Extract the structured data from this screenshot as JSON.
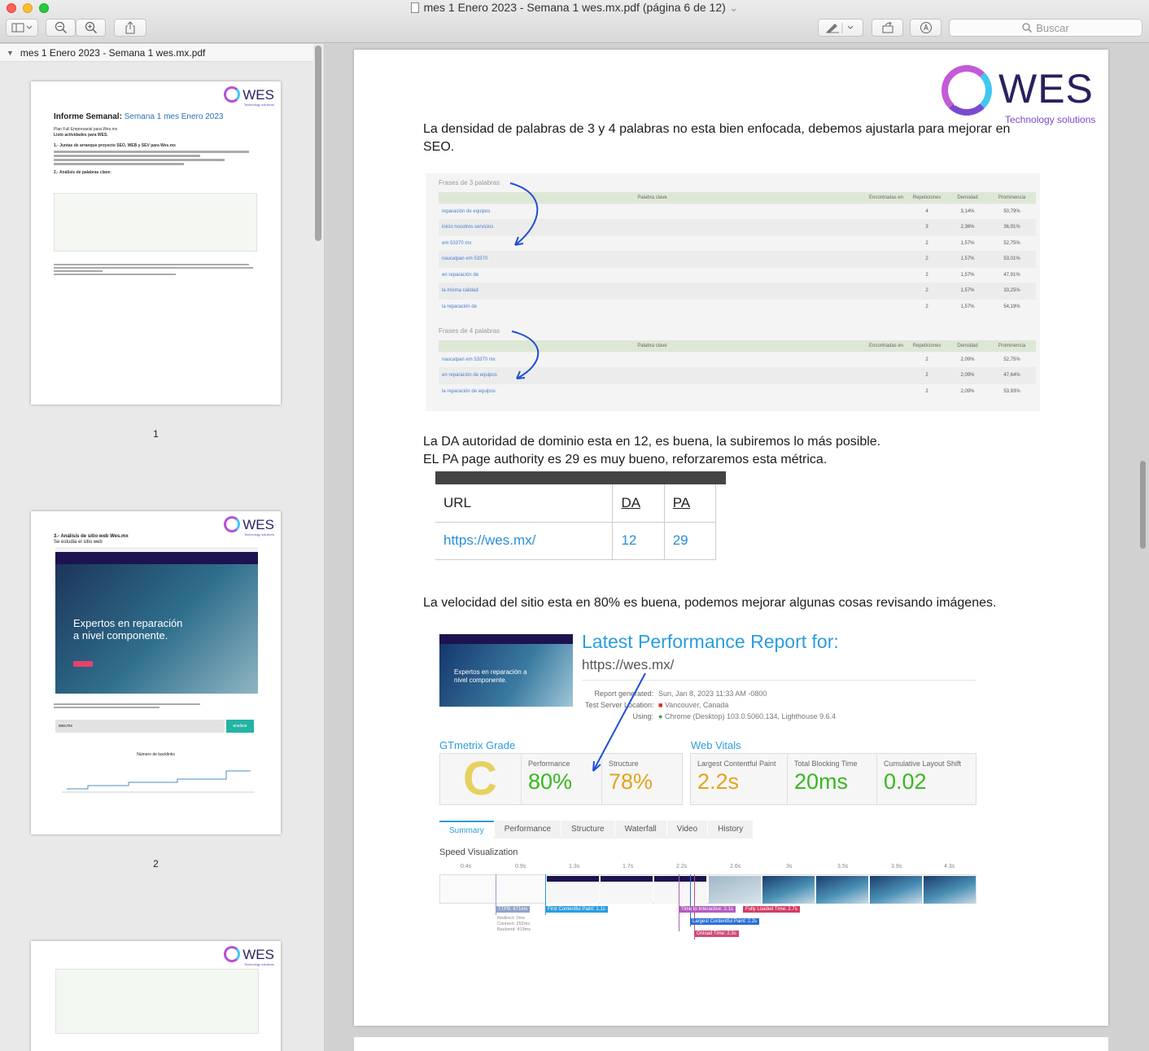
{
  "window": {
    "title": "mes 1 Enero 2023 - Semana 1 wes.mx.pdf (página 6 de 12)",
    "chevron": "⌄"
  },
  "toolbar": {
    "sidebar_icon": "sidebar-icon",
    "zoom_out_icon": "zoom-out-icon",
    "zoom_in_icon": "zoom-in-icon",
    "share_icon": "share-icon",
    "markup_icon": "pen-icon",
    "rotate_icon": "rotate-icon",
    "annotate_icon": "annotate-icon",
    "search_placeholder": "Buscar"
  },
  "sidebar": {
    "file_name": "mes 1 Enero 2023 - Semana 1 wes.mx.pdf",
    "pages": [
      {
        "number": "1"
      },
      {
        "number": "2"
      }
    ],
    "thumb1": {
      "title_a": "Informe Semanal:",
      "title_b": "Semana 1 mes Enero 2023",
      "l1": "Plan Full Empresarial para Wes.mx",
      "l2": "Listo actividades para WES.",
      "l3": "1.- Juntas de arranque proyecto SEO, WEB y SEV para Wes.mx",
      "l4": "2.- Análisis de palabras clave:"
    },
    "thumb2": {
      "heading": "3.- Análisis de sitio web Wes.mx",
      "sub": "Se estudia el sitio web",
      "hero": "Expertos en reparación a nivel componente.",
      "analyze": "analizar",
      "domain": "wes.mx",
      "chart_title": "Número de backlinks"
    },
    "logo_text": "WES",
    "logo_sub": "Technology solutions"
  },
  "page": {
    "logo_text": "WES",
    "logo_sub": "Technology solutions",
    "p1": "La densidad de palabras de 3 y 4 palabras no esta bien enfocada, debemos ajustarla para mejorar en SEO.",
    "p2a": "La DA autoridad de dominio esta en 12, es buena, la subiremos lo más posible.",
    "p2b": "EL PA page authority es 29 es muy bueno, reforzaremos esta métrica.",
    "p3": "La velocidad del sitio esta en 80% es buena, podemos mejorar algunas cosas revisando imágenes."
  },
  "keywords": {
    "headers": [
      "Palabra clave",
      "Encontradas en",
      "Repeticiones",
      "Densidad",
      "Prominencia"
    ],
    "three": {
      "title": "Frases de 3 palabras",
      "rows": [
        [
          "reparación de equipos",
          "",
          "4",
          "3,14%",
          "50,79%"
        ],
        [
          "inicio nosotros servicios",
          "",
          "3",
          "2,36%",
          "36,91%"
        ],
        [
          "em 53370 mx",
          "",
          "2",
          "1,57%",
          "52,75%"
        ],
        [
          "naucalpan em 53370",
          "",
          "2",
          "1,57%",
          "53,01%"
        ],
        [
          "en reparación de",
          "",
          "2",
          "1,57%",
          "47,91%"
        ],
        [
          "la misma calidad",
          "",
          "2",
          "1,57%",
          "33,25%"
        ],
        [
          "la reparación de",
          "",
          "2",
          "1,57%",
          "54,19%"
        ]
      ]
    },
    "four": {
      "title": "Frases de 4 palabras",
      "rows": [
        [
          "naucalpan em 53370 mx",
          "",
          "2",
          "2,09%",
          "52,75%"
        ],
        [
          "en reparación de equipos",
          "",
          "2",
          "2,09%",
          "47,64%"
        ],
        [
          "la reparación de equipos",
          "",
          "2",
          "2,09%",
          "53,93%"
        ]
      ]
    }
  },
  "authority": {
    "h_url": "URL",
    "h_da": "DA",
    "h_pa": "PA",
    "url": "https://wes.mx/",
    "da": "12",
    "pa": "29"
  },
  "gtmetrix": {
    "heading": "Latest Performance Report for:",
    "url": "https://wes.mx/",
    "shot_text": "Expertos en reparación a nivel componente.",
    "report_label": "Report generated:",
    "report_value": "Sun, Jan 8, 2023 11:33 AM -0800",
    "server_label": "Test Server Location:",
    "server_value": "Vancouver, Canada",
    "using_label": "Using:",
    "using_value": "Chrome (Desktop) 103.0.5060.134, Lighthouse 9.6.4",
    "grade_title": "GTmetrix Grade",
    "grade": "C",
    "perf_label": "Performance",
    "perf_value": "80%",
    "struct_label": "Structure",
    "struct_value": "78%",
    "vitals_title": "Web Vitals",
    "lcp_label": "Largest Contentful Paint",
    "lcp_value": "2.2s",
    "tbt_label": "Total Blocking Time",
    "tbt_value": "20ms",
    "cls_label": "Cumulative Layout Shift",
    "cls_value": "0.02",
    "tabs": [
      "Summary",
      "Performance",
      "Structure",
      "Waterfall",
      "Video",
      "History"
    ],
    "speed_title": "Speed Visualization",
    "ticks": [
      "0.4s",
      "0.9s",
      "1.3s",
      "1.7s",
      "2.2s",
      "2.6s",
      "3s",
      "3.5s",
      "3.9s",
      "4.3s"
    ],
    "m_ttfb": "TTFB: 671ms",
    "m_fcp": "First Contentful Paint: 1.1s",
    "m_tti": "Time to Interactive: 2.1s",
    "m_flt": "Fully Loaded Time: 2.7s",
    "m_lcp": "Largest Contentful Paint: 2.2s",
    "m_onload": "Onload Time: 2.3s",
    "ttfb_detail": "Redirect: 0ms Connect: 252ms Backend: 419ms",
    "colors": {
      "blue": "#2b9de0",
      "green": "#38b820",
      "amber": "#e5a21c",
      "grade": "#e6d160"
    }
  }
}
